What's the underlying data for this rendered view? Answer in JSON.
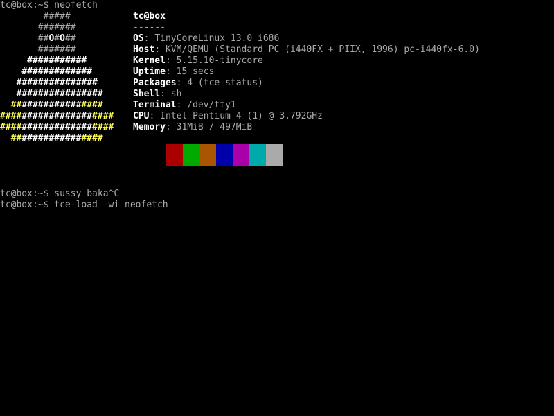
{
  "terminal": {
    "first_command": "tc@box:~$ neofetch",
    "logo_lines": [
      "        #####",
      "       #######",
      "       ##O#O##",
      "       #######",
      "     ###########",
      "    #############",
      "   ###############",
      "   ################",
      "  #################",
      "#####################",
      "#####################",
      "  #################"
    ],
    "info": {
      "title_user": "tc@box",
      "title_separator": "------",
      "rows": [
        {
          "key": "OS",
          "value": "TinyCoreLinux 13.0 i686"
        },
        {
          "key": "Host",
          "value": "KVM/QEMU (Standard PC (i440FX + PIIX, 1996) pc-i440fx-6.0)"
        },
        {
          "key": "Kernel",
          "value": "5.15.10-tinycore"
        },
        {
          "key": "Uptime",
          "value": "15 secs"
        },
        {
          "key": "Packages",
          "value": "4 (tce-status)"
        },
        {
          "key": "Shell",
          "value": "sh"
        },
        {
          "key": "Terminal",
          "value": "/dev/tty1"
        },
        {
          "key": "CPU",
          "value": "Intel Pentium 4 (1) @ 3.792GHz"
        },
        {
          "key": "Memory",
          "value": "31MiB / 497MiB"
        }
      ]
    },
    "palette_colors": [
      "#000000",
      "#aa0000",
      "#00aa00",
      "#aa5500",
      "#0000aa",
      "#aa00aa",
      "#00aaaa",
      "#aaaaaa"
    ],
    "later_lines": [
      "tc@box:~$ sussy baka^C",
      "tc@box:~$ tce-load -wi neofetch"
    ]
  }
}
